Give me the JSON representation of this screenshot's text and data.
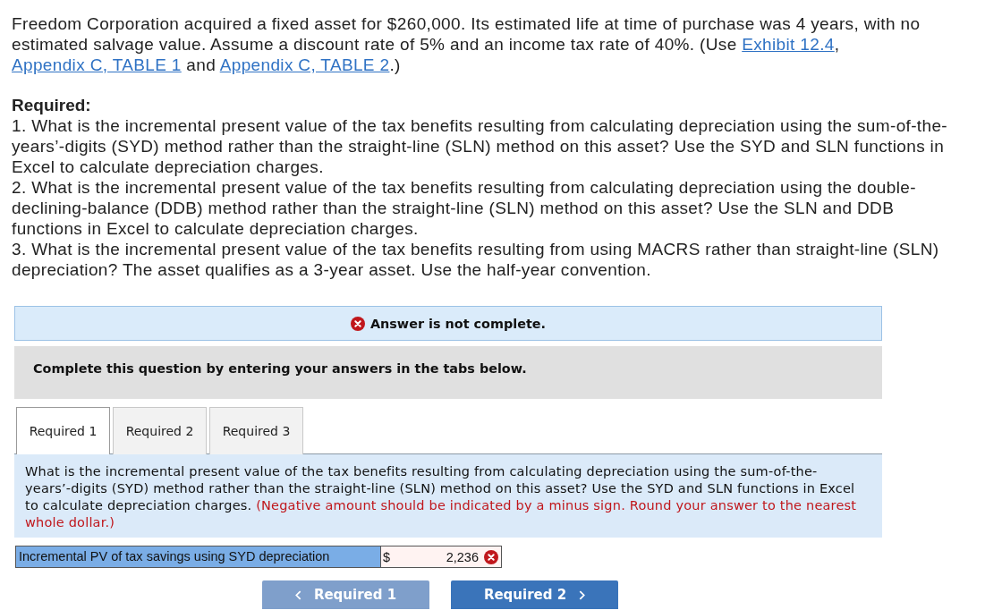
{
  "problem": {
    "intro": [
      {
        "kind": "text",
        "text": "Freedom Corporation acquired a fixed asset for $260,000. Its estimated life at time of purchase was 4 years, with no estimated salvage value. Assume a discount rate of 5% and an income tax rate of 40%. (Use "
      },
      {
        "kind": "link",
        "text": "Exhibit 12.4"
      },
      {
        "kind": "text",
        "text": ", "
      },
      {
        "kind": "link",
        "text": "Appendix C, TABLE 1"
      },
      {
        "kind": "text",
        "text": " and "
      },
      {
        "kind": "link",
        "text": "Appendix C, TABLE 2"
      },
      {
        "kind": "text",
        "text": ".)"
      }
    ],
    "required_heading": "Required:",
    "requirements": [
      "1. What is the incremental present value of the tax benefits resulting from calculating depreciation using the sum-of-the-years’-digits (SYD) method rather than the straight-line (SLN) method on this asset? Use the SYD and SLN functions in Excel to calculate depreciation charges.",
      "2. What is the incremental present value of the tax benefits resulting from calculating depreciation using the double-declining-balance (DDB) method rather than the straight-line (SLN) method on this asset? Use the SLN and DDB functions in Excel to calculate depreciation charges.",
      "3. What is the incremental present value of the tax benefits resulting from using MACRS rather than straight-line (SLN) depreciation? The asset qualifies as a 3-year asset. Use the half-year convention."
    ]
  },
  "answer_status": {
    "complete": false,
    "message": "Answer is not complete."
  },
  "instructions": "Complete this question by entering your answers in the tabs below.",
  "tabs": [
    {
      "label": "Required 1",
      "selected": true
    },
    {
      "label": "Required 2",
      "selected": false
    },
    {
      "label": "Required 3",
      "selected": false
    }
  ],
  "question": {
    "prompt": "What is the incremental present value of the tax benefits resulting from calculating depreciation using the sum-of-the-years’-digits (SYD) method rather than the straight-line (SLN) method on this asset? Use the SYD and SLN functions in Excel to calculate depreciation charges.",
    "note": "(Negative amount should be indicated by a minus sign. Round your answer to the nearest whole dollar.)"
  },
  "answer_rows": [
    {
      "label": "Incremental PV of tax savings using SYD depreciation",
      "currency": "$",
      "value": "2,236",
      "correct": false
    }
  ],
  "navigation": {
    "previous": {
      "label": "Required 1",
      "disabled": true
    },
    "next": {
      "label": "Required 2",
      "disabled": false
    }
  }
}
